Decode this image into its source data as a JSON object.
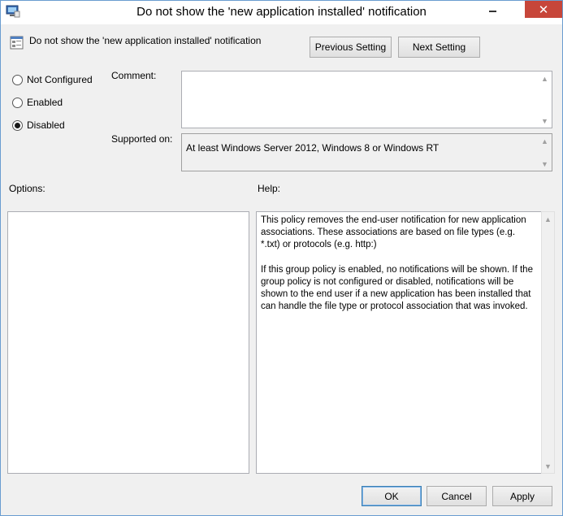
{
  "window": {
    "title": "Do not show the 'new application installed' notification",
    "close_glyph": "✕"
  },
  "header": {
    "policy_name": "Do not show the 'new application installed' notification",
    "prev_label": "Previous Setting",
    "next_label": "Next Setting"
  },
  "state": {
    "options": [
      {
        "label": "Not Configured",
        "checked": false
      },
      {
        "label": "Enabled",
        "checked": false
      },
      {
        "label": "Disabled",
        "checked": true
      }
    ]
  },
  "comment": {
    "label": "Comment:",
    "value": ""
  },
  "supported": {
    "label": "Supported on:",
    "value": "At least Windows Server 2012, Windows 8 or Windows RT"
  },
  "options_panel": {
    "label": "Options:"
  },
  "help": {
    "label": "Help:",
    "text": "This policy removes the end-user notification for new application associations. These associations are based on file types (e.g. *.txt) or protocols (e.g. http:)\n\nIf this group policy is enabled, no notifications will be shown. If the group policy is not configured or disabled, notifications will be shown to the end user if a new application has been installed that can handle the file type or protocol association that was invoked."
  },
  "footer": {
    "ok_label": "OK",
    "cancel_label": "Cancel",
    "apply_label": "Apply"
  },
  "icons": {
    "app": "group-policy-icon",
    "policy": "policy-setting-icon",
    "scroll_up": "▲",
    "scroll_down": "▼"
  }
}
